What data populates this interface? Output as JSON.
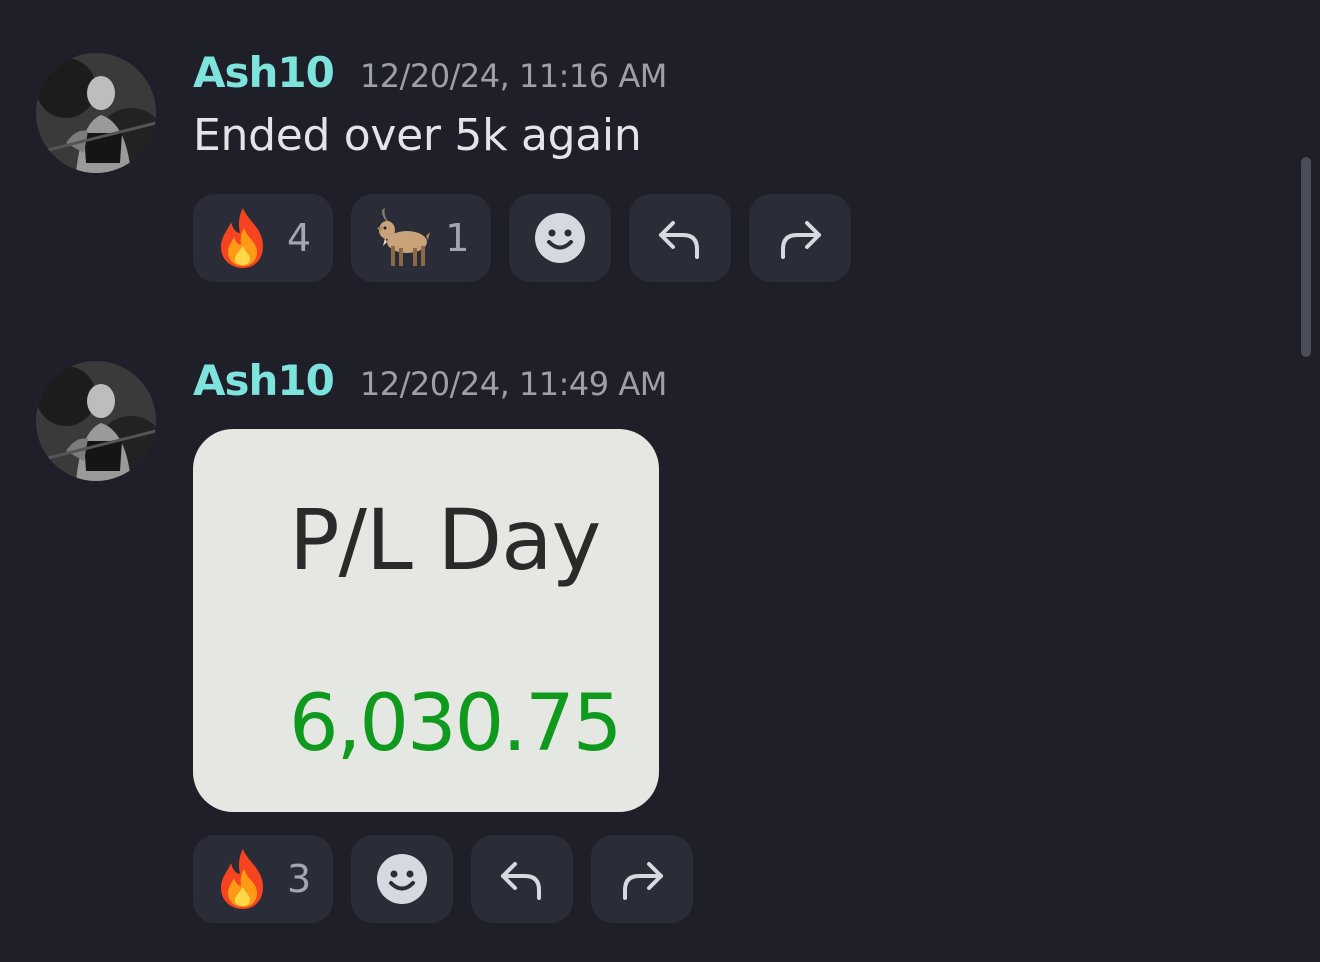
{
  "messages": [
    {
      "username": "Ash10",
      "timestamp": "12/20/24, 11:16 AM",
      "text": "Ended over 5k again",
      "reactions": [
        {
          "emoji": "fire",
          "count": "4"
        },
        {
          "emoji": "goat",
          "count": "1"
        }
      ],
      "actions": [
        "add-reaction-icon",
        "reply-icon",
        "forward-icon"
      ]
    },
    {
      "username": "Ash10",
      "timestamp": "12/20/24, 11:49 AM",
      "attachment": {
        "label": "P/L Day",
        "value": "6,030.75",
        "value_color": "#0f9a1e"
      },
      "reactions": [
        {
          "emoji": "fire",
          "count": "3"
        }
      ],
      "actions": [
        "add-reaction-icon",
        "reply-icon",
        "forward-icon"
      ]
    }
  ],
  "colors": {
    "background": "#1e1f29",
    "username": "#7de3dc",
    "timestamp": "#9c9ea8",
    "pill": "#2a2c37"
  }
}
